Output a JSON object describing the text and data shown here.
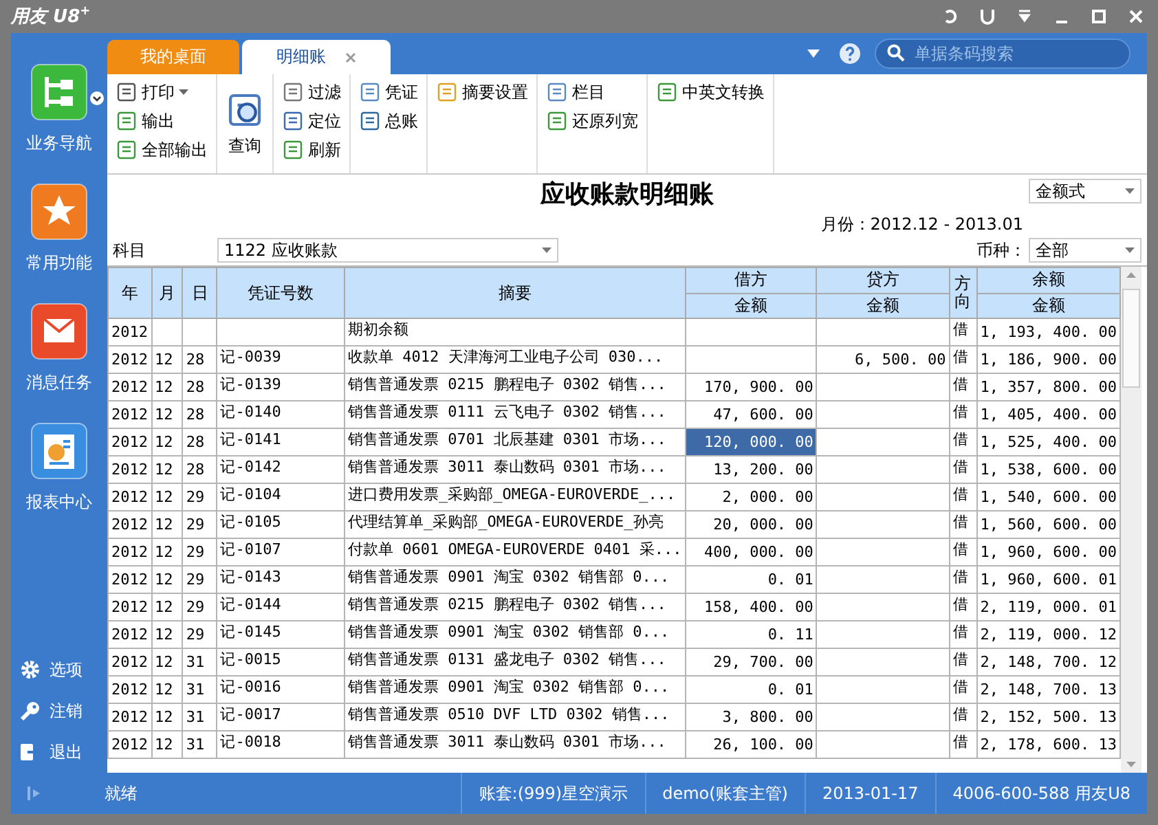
{
  "window": {
    "logo": "用友 U8",
    "logo_sup": "+"
  },
  "sidebar": {
    "items": [
      {
        "label": "业务导航",
        "kind": "nav",
        "has_menu": true
      },
      {
        "label": "常用功能",
        "kind": "star",
        "has_menu": false
      },
      {
        "label": "消息任务",
        "kind": "mail",
        "has_menu": false
      },
      {
        "label": "报表中心",
        "kind": "report",
        "has_menu": false
      }
    ],
    "links": [
      {
        "label": "选项",
        "kind": "gear"
      },
      {
        "label": "注销",
        "kind": "key"
      },
      {
        "label": "退出",
        "kind": "exit"
      }
    ]
  },
  "tabs": [
    {
      "label": "我的桌面",
      "selected": false,
      "closable": false
    },
    {
      "label": "明细账",
      "selected": true,
      "closable": true
    }
  ],
  "search": {
    "placeholder": "单据条码搜索"
  },
  "toolbar": [
    [
      {
        "label": "打印",
        "kind": "print",
        "dropdown": true
      },
      {
        "label": "输出",
        "kind": "export",
        "dropdown": false
      },
      {
        "label": "全部输出",
        "kind": "export",
        "dropdown": false
      }
    ],
    [
      {
        "label": "查询",
        "kind": "query",
        "dropdown": false
      }
    ],
    [
      {
        "label": "过滤",
        "kind": "filter",
        "dropdown": false
      },
      {
        "label": "定位",
        "kind": "locate",
        "dropdown": false
      },
      {
        "label": "刷新",
        "kind": "refresh",
        "dropdown": false
      }
    ],
    [
      {
        "label": "凭证",
        "kind": "voucher",
        "dropdown": false
      },
      {
        "label": "总账",
        "kind": "ledger",
        "dropdown": false
      }
    ],
    [
      {
        "label": "摘要设置",
        "kind": "summary",
        "dropdown": false
      }
    ],
    [
      {
        "label": "栏目",
        "kind": "columns",
        "dropdown": false
      },
      {
        "label": "还原列宽",
        "kind": "restore",
        "dropdown": false
      }
    ],
    [
      {
        "label": "中英文转换",
        "kind": "translate",
        "dropdown": false
      }
    ]
  ],
  "report": {
    "title": "应收账款明细账",
    "format": "金额式",
    "period": "月份：2012.12 - 2013.01",
    "account_label": "科目",
    "account": "1122 应收账款",
    "currency_label": "币种：",
    "currency": "全部"
  },
  "table": {
    "columns": [
      "年",
      "月",
      "日",
      "凭证号数",
      "摘要",
      "借方",
      "贷方",
      "方向",
      "余额"
    ],
    "subcolumns": [
      "金额",
      "金额",
      "金额"
    ],
    "rows": [
      {
        "year": "2012",
        "month": "",
        "day": "",
        "voucher": "",
        "summary": "期初余额",
        "debit": "",
        "credit": "",
        "dir": "借",
        "balance": "1, 193, 400. 00",
        "selected": false
      },
      {
        "year": "2012",
        "month": "12",
        "day": "28",
        "voucher": "记-0039",
        "summary": "收款单 4012 天津海河工业电子公司 030...",
        "debit": "",
        "credit": "6, 500. 00",
        "dir": "借",
        "balance": "1, 186, 900. 00",
        "selected": false
      },
      {
        "year": "2012",
        "month": "12",
        "day": "28",
        "voucher": "记-0139",
        "summary": "销售普通发票 0215 鹏程电子 0302 销售...",
        "debit": "170, 900. 00",
        "credit": "",
        "dir": "借",
        "balance": "1, 357, 800. 00",
        "selected": false
      },
      {
        "year": "2012",
        "month": "12",
        "day": "28",
        "voucher": "记-0140",
        "summary": "销售普通发票 0111 云飞电子 0302 销售...",
        "debit": "47, 600. 00",
        "credit": "",
        "dir": "借",
        "balance": "1, 405, 400. 00",
        "selected": false
      },
      {
        "year": "2012",
        "month": "12",
        "day": "28",
        "voucher": "记-0141",
        "summary": "销售普通发票 0701 北辰基建 0301 市场...",
        "debit": "120, 000. 00",
        "credit": "",
        "dir": "借",
        "balance": "1, 525, 400. 00",
        "selected": true
      },
      {
        "year": "2012",
        "month": "12",
        "day": "28",
        "voucher": "记-0142",
        "summary": "销售普通发票 3011 泰山数码 0301 市场...",
        "debit": "13, 200. 00",
        "credit": "",
        "dir": "借",
        "balance": "1, 538, 600. 00",
        "selected": false
      },
      {
        "year": "2012",
        "month": "12",
        "day": "29",
        "voucher": "记-0104",
        "summary": "进口费用发票_采购部_OMEGA-EUROVERDE_...",
        "debit": "2, 000. 00",
        "credit": "",
        "dir": "借",
        "balance": "1, 540, 600. 00",
        "selected": false
      },
      {
        "year": "2012",
        "month": "12",
        "day": "29",
        "voucher": "记-0105",
        "summary": "代理结算单_采购部_OMEGA-EUROVERDE_孙亮",
        "debit": "20, 000. 00",
        "credit": "",
        "dir": "借",
        "balance": "1, 560, 600. 00",
        "selected": false
      },
      {
        "year": "2012",
        "month": "12",
        "day": "29",
        "voucher": "记-0107",
        "summary": "付款单 0601 OMEGA-EUROVERDE 0401 采...",
        "debit": "400, 000. 00",
        "credit": "",
        "dir": "借",
        "balance": "1, 960, 600. 00",
        "selected": false
      },
      {
        "year": "2012",
        "month": "12",
        "day": "29",
        "voucher": "记-0143",
        "summary": "销售普通发票 0901 淘宝 0302 销售部 0...",
        "debit": "0. 01",
        "credit": "",
        "dir": "借",
        "balance": "1, 960, 600. 01",
        "selected": false
      },
      {
        "year": "2012",
        "month": "12",
        "day": "29",
        "voucher": "记-0144",
        "summary": "销售普通发票 0215 鹏程电子 0302 销售...",
        "debit": "158, 400. 00",
        "credit": "",
        "dir": "借",
        "balance": "2, 119, 000. 01",
        "selected": false
      },
      {
        "year": "2012",
        "month": "12",
        "day": "29",
        "voucher": "记-0145",
        "summary": "销售普通发票 0901 淘宝 0302 销售部 0...",
        "debit": "0. 11",
        "credit": "",
        "dir": "借",
        "balance": "2, 119, 000. 12",
        "selected": false
      },
      {
        "year": "2012",
        "month": "12",
        "day": "31",
        "voucher": "记-0015",
        "summary": "销售普通发票 0131 盛龙电子 0302 销售...",
        "debit": "29, 700. 00",
        "credit": "",
        "dir": "借",
        "balance": "2, 148, 700. 12",
        "selected": false
      },
      {
        "year": "2012",
        "month": "12",
        "day": "31",
        "voucher": "记-0016",
        "summary": "销售普通发票 0901 淘宝 0302 销售部 0...",
        "debit": "0. 01",
        "credit": "",
        "dir": "借",
        "balance": "2, 148, 700. 13",
        "selected": false
      },
      {
        "year": "2012",
        "month": "12",
        "day": "31",
        "voucher": "记-0017",
        "summary": "销售普通发票 0510 DVF LTD 0302 销售...",
        "debit": "3, 800. 00",
        "credit": "",
        "dir": "借",
        "balance": "2, 152, 500. 13",
        "selected": false
      },
      {
        "year": "2012",
        "month": "12",
        "day": "31",
        "voucher": "记-0018",
        "summary": "销售普通发票 3011 泰山数码 0301 市场...",
        "debit": "26, 100. 00",
        "credit": "",
        "dir": "借",
        "balance": "2, 178, 600. 13",
        "selected": false
      }
    ]
  },
  "status_bar": [
    "就绪",
    "账套:(999)星空演示",
    "demo(账套主管)",
    "2013-01-17",
    "4006-600-588 用友U8"
  ]
}
